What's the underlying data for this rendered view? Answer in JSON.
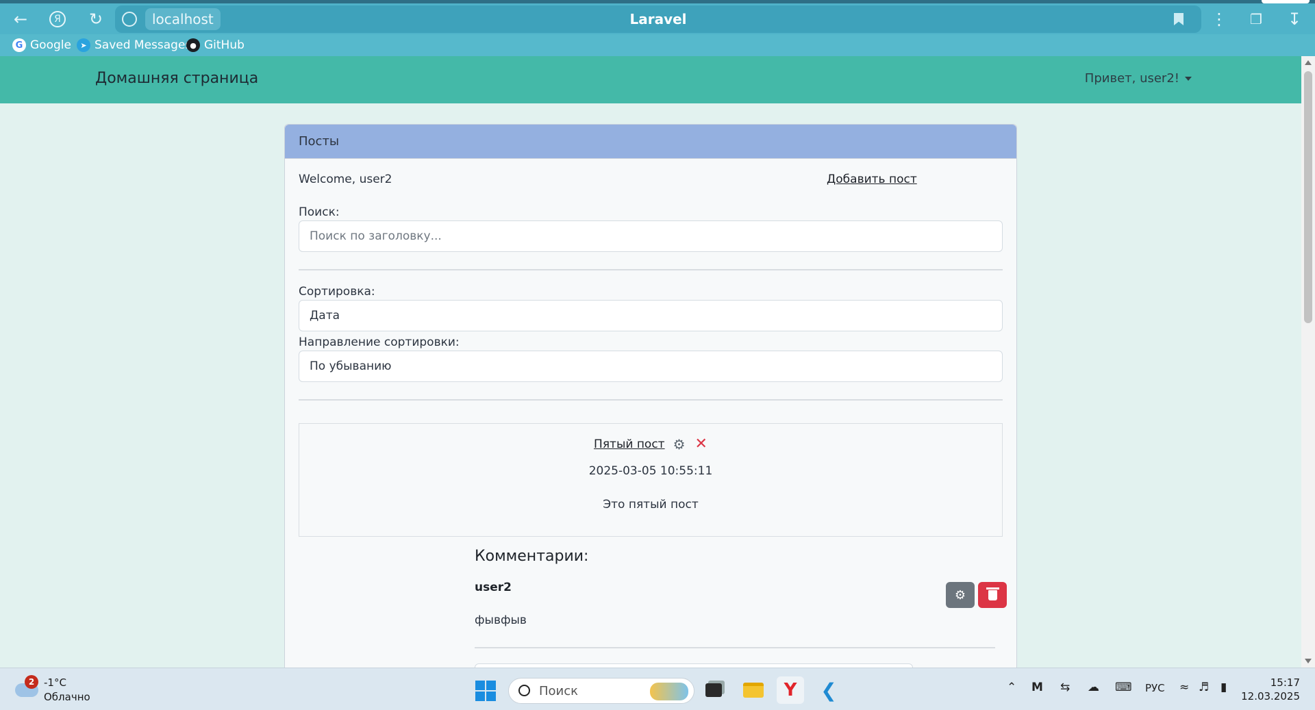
{
  "browser": {
    "url_host": "localhost",
    "tab_title": "Laravel",
    "bookmarks": [
      "Google",
      "Saved Messages",
      "GitHub"
    ]
  },
  "app": {
    "brand": "Домашняя страница",
    "user_menu": "Привет, user2!"
  },
  "card": {
    "header": "Посты",
    "welcome": "Welcome, user2",
    "add_post": "Добавить пост",
    "search_label": "Поиск:",
    "search_placeholder": "Поиск по заголовку...",
    "sort_label": "Сортировка:",
    "sort_value": "Дата",
    "sort_dir_label": "Направление сортировки:",
    "sort_dir_value": "По убыванию"
  },
  "post": {
    "title": "Пятый пост",
    "date": "2025-03-05 10:55:11",
    "body": "Это пятый пост"
  },
  "comments": {
    "heading": "Комментарии:",
    "items": [
      {
        "author": "user2",
        "text": "фывфыв"
      }
    ]
  },
  "taskbar": {
    "weather_badge": "2",
    "weather_temp": "-1°C",
    "weather_desc": "Облачно",
    "search": "Поиск",
    "lang": "РУС",
    "time": "15:17",
    "date": "12.03.2025"
  },
  "colors": {
    "navbar": "#44b9a8",
    "card_header": "#94b0e0",
    "danger": "#dc3545",
    "secondary": "#6c757d"
  }
}
